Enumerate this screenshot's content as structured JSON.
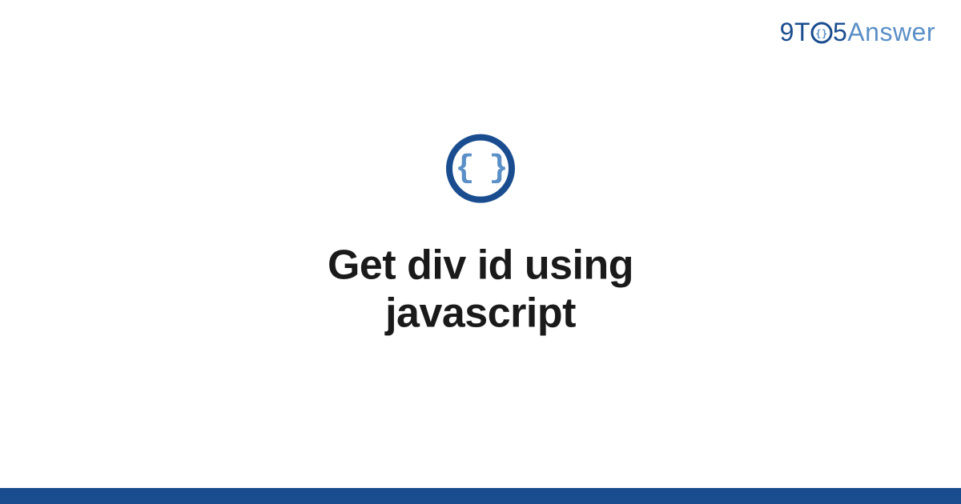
{
  "logo": {
    "part1": "9T",
    "part2": "5",
    "part3": "Answer"
  },
  "category_icon_glyph": "{ }",
  "title": "Get div id using javascript",
  "colors": {
    "primary": "#1a4d8f",
    "secondary": "#5a8fc7",
    "text": "#1a1a1a"
  }
}
